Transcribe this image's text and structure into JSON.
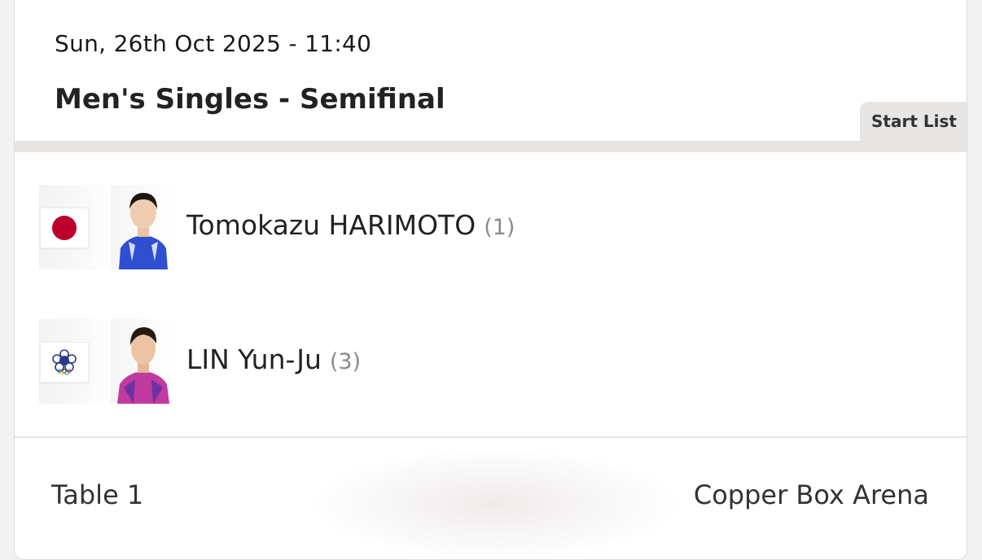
{
  "match": {
    "datetime": "Sun, 26th Oct 2025 - 11:40",
    "event": "Men's Singles - Semifinal",
    "start_list_label": "Start List"
  },
  "competitors": [
    {
      "name": "Tomokazu HARIMOTO",
      "seed": "(1)",
      "country_flag": "japan-flag-icon",
      "jersey_color": "#2f4fd0"
    },
    {
      "name": "LIN Yun-Ju",
      "seed": "(3)",
      "country_flag": "chinese-taipei-flag-icon",
      "jersey_color": "#c03aa0"
    }
  ],
  "footer": {
    "table": "Table 1",
    "venue": "Copper Box Arena"
  },
  "colors": {
    "japan_red": "#bc002d",
    "tab_background": "#e8e5e5",
    "seed_grey": "#8a8a8a"
  }
}
